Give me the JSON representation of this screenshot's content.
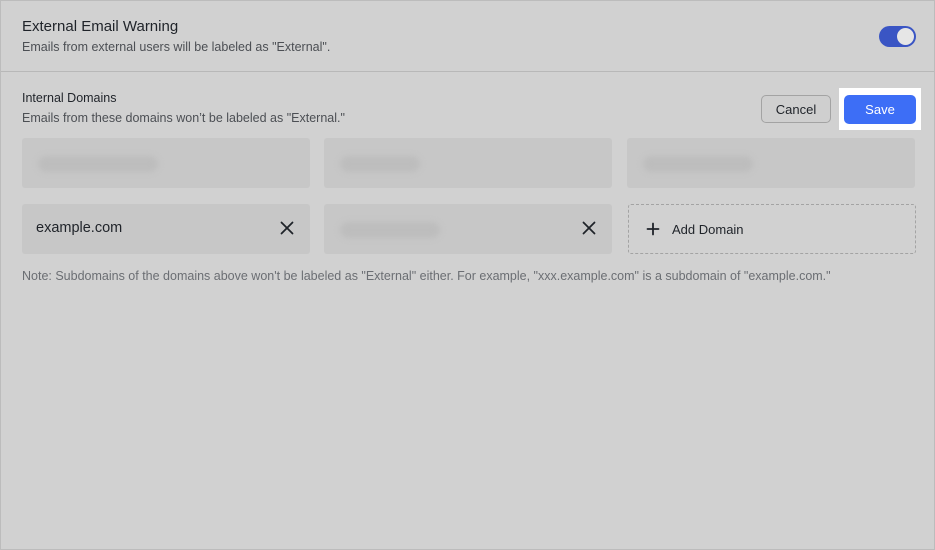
{
  "external_warning": {
    "title": "External Email Warning",
    "description": "Emails from external users will be labeled as \"External\".",
    "toggle_on": true,
    "toggle_color": "#3a55c4"
  },
  "internal_domains": {
    "title": "Internal Domains",
    "description": "Emails from these domains won’t be labeled as \"External.\"",
    "cancel_label": "Cancel",
    "save_label": "Save",
    "save_color": "#3d6ef6",
    "domains": [
      {
        "value": "",
        "redacted": true
      },
      {
        "value": "",
        "redacted": true
      },
      {
        "value": "",
        "redacted": true
      },
      {
        "value": "example.com",
        "redacted": false,
        "removable": true
      },
      {
        "value": "",
        "redacted": true,
        "removable": true
      }
    ],
    "add_domain_label": "Add Domain",
    "note": "Note: Subdomains of the domains above won't be labeled as \"External\" either. For example, \"xxx.example.com\" is a subdomain of \"example.com.\""
  }
}
